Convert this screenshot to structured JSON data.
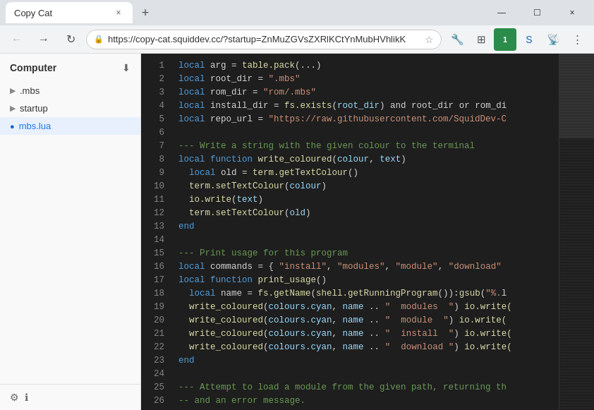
{
  "browser": {
    "title": "Copy Cat",
    "tab_close": "×",
    "new_tab": "+",
    "minimize": "—",
    "maximize": "☐",
    "close": "×",
    "back": "←",
    "forward": "→",
    "reload": "↻",
    "url": "https://copy-cat.squiddev.cc/?startup=ZnMuZGVsZXRlKCtYnMubHVhlikK",
    "star": "☆",
    "lock": "🔒"
  },
  "sidebar": {
    "title": "Computer",
    "download_icon": "⬇",
    "items": [
      {
        "id": "mbs",
        "icon": "▶",
        "label": ".mbs",
        "active": false
      },
      {
        "id": "startup",
        "icon": "▶",
        "label": "startup",
        "active": false
      },
      {
        "id": "mbs-lua",
        "icon": "●",
        "label": "mbs.lua",
        "active": true
      }
    ],
    "footer": {
      "settings_icon": "⚙",
      "info_icon": "ℹ"
    }
  },
  "code": {
    "lines": [
      {
        "num": 1,
        "tokens": [
          {
            "t": "kw",
            "v": "local"
          },
          {
            "t": "op",
            "v": " arg = "
          },
          {
            "t": "fn",
            "v": "table.pack"
          },
          {
            "t": "punc",
            "v": "(...)"
          }
        ]
      },
      {
        "num": 2,
        "tokens": [
          {
            "t": "kw",
            "v": "local"
          },
          {
            "t": "op",
            "v": " root_dir = "
          },
          {
            "t": "str",
            "v": "\".mbs\""
          }
        ]
      },
      {
        "num": 3,
        "tokens": [
          {
            "t": "kw",
            "v": "local"
          },
          {
            "t": "op",
            "v": " rom_dir = "
          },
          {
            "t": "str",
            "v": "\"rom/.mbs\""
          }
        ]
      },
      {
        "num": 4,
        "tokens": [
          {
            "t": "kw",
            "v": "local"
          },
          {
            "t": "op",
            "v": " install_dir = "
          },
          {
            "t": "fn",
            "v": "fs.exists"
          },
          {
            "t": "punc",
            "v": "("
          },
          {
            "t": "var",
            "v": "root_dir"
          },
          {
            "t": "punc",
            "v": ")"
          },
          {
            "t": "op",
            "v": " and root_dir or rom_di"
          }
        ]
      },
      {
        "num": 5,
        "tokens": [
          {
            "t": "kw",
            "v": "local"
          },
          {
            "t": "op",
            "v": " repo_url = "
          },
          {
            "t": "str",
            "v": "\"https://raw.githubusercontent.com/SquidDev-C"
          }
        ]
      },
      {
        "num": 6,
        "tokens": []
      },
      {
        "num": 7,
        "tokens": [
          {
            "t": "comment",
            "v": "--- Write a string with the given colour to the terminal"
          }
        ]
      },
      {
        "num": 8,
        "tokens": [
          {
            "t": "kw",
            "v": "local"
          },
          {
            "t": "op",
            "v": " "
          },
          {
            "t": "kw",
            "v": "function"
          },
          {
            "t": "op",
            "v": " "
          },
          {
            "t": "fn",
            "v": "write_coloured"
          },
          {
            "t": "punc",
            "v": "("
          },
          {
            "t": "var",
            "v": "colour"
          },
          {
            "t": "punc",
            "v": ", "
          },
          {
            "t": "var",
            "v": "text"
          },
          {
            "t": "punc",
            "v": ")"
          }
        ]
      },
      {
        "num": 9,
        "tokens": [
          {
            "t": "indent",
            "v": "  "
          },
          {
            "t": "kw",
            "v": "local"
          },
          {
            "t": "op",
            "v": " old = "
          },
          {
            "t": "fn",
            "v": "term.getTextColour"
          },
          {
            "t": "punc",
            "v": "()"
          }
        ]
      },
      {
        "num": 10,
        "tokens": [
          {
            "t": "indent",
            "v": "  "
          },
          {
            "t": "fn",
            "v": "term.setTextColour"
          },
          {
            "t": "punc",
            "v": "("
          },
          {
            "t": "var",
            "v": "colour"
          },
          {
            "t": "punc",
            "v": ")"
          }
        ]
      },
      {
        "num": 11,
        "tokens": [
          {
            "t": "indent",
            "v": "  "
          },
          {
            "t": "fn",
            "v": "io.write"
          },
          {
            "t": "punc",
            "v": "("
          },
          {
            "t": "var",
            "v": "text"
          },
          {
            "t": "punc",
            "v": ")"
          }
        ]
      },
      {
        "num": 12,
        "tokens": [
          {
            "t": "indent",
            "v": "  "
          },
          {
            "t": "fn",
            "v": "term.setTextColour"
          },
          {
            "t": "punc",
            "v": "("
          },
          {
            "t": "var",
            "v": "old"
          },
          {
            "t": "punc",
            "v": ")"
          }
        ]
      },
      {
        "num": 13,
        "tokens": [
          {
            "t": "kw",
            "v": "end"
          }
        ]
      },
      {
        "num": 14,
        "tokens": []
      },
      {
        "num": 15,
        "tokens": [
          {
            "t": "comment",
            "v": "--- Print usage for this program"
          }
        ]
      },
      {
        "num": 16,
        "tokens": [
          {
            "t": "kw",
            "v": "local"
          },
          {
            "t": "op",
            "v": " commands = { "
          },
          {
            "t": "str",
            "v": "\"install\""
          },
          {
            "t": "op",
            "v": ", "
          },
          {
            "t": "str",
            "v": "\"modules\""
          },
          {
            "t": "op",
            "v": ", "
          },
          {
            "t": "str",
            "v": "\"module\""
          },
          {
            "t": "op",
            "v": ", "
          },
          {
            "t": "str",
            "v": "\"download\""
          }
        ]
      },
      {
        "num": 17,
        "tokens": [
          {
            "t": "kw",
            "v": "local"
          },
          {
            "t": "op",
            "v": " "
          },
          {
            "t": "kw",
            "v": "function"
          },
          {
            "t": "op",
            "v": " "
          },
          {
            "t": "fn",
            "v": "print_usage"
          },
          {
            "t": "punc",
            "v": "()"
          }
        ]
      },
      {
        "num": 18,
        "tokens": [
          {
            "t": "indent",
            "v": "  "
          },
          {
            "t": "kw",
            "v": "local"
          },
          {
            "t": "op",
            "v": " name = "
          },
          {
            "t": "fn",
            "v": "fs.getName"
          },
          {
            "t": "punc",
            "v": "("
          },
          {
            "t": "fn",
            "v": "shell.getRunningProgram"
          },
          {
            "t": "punc",
            "v": "()):"
          },
          {
            "t": "fn",
            "v": "gsub"
          },
          {
            "t": "punc",
            "v": "("
          },
          {
            "t": "str",
            "v": "\"%."
          },
          {
            "t": "op",
            "v": "l"
          }
        ]
      },
      {
        "num": 19,
        "tokens": [
          {
            "t": "indent",
            "v": "  "
          },
          {
            "t": "fn",
            "v": "write_coloured"
          },
          {
            "t": "punc",
            "v": "("
          },
          {
            "t": "var",
            "v": "colours.cyan"
          },
          {
            "t": "punc",
            "v": ", "
          },
          {
            "t": "var",
            "v": "name"
          },
          {
            "t": "op",
            "v": " .. "
          },
          {
            "t": "str",
            "v": "\"  modules  \""
          },
          {
            "t": "punc",
            "v": ")"
          },
          {
            "t": "op",
            "v": " "
          },
          {
            "t": "fn",
            "v": "io.write("
          }
        ]
      },
      {
        "num": 20,
        "tokens": [
          {
            "t": "indent",
            "v": "  "
          },
          {
            "t": "fn",
            "v": "write_coloured"
          },
          {
            "t": "punc",
            "v": "("
          },
          {
            "t": "var",
            "v": "colours.cyan"
          },
          {
            "t": "punc",
            "v": ", "
          },
          {
            "t": "var",
            "v": "name"
          },
          {
            "t": "op",
            "v": " .. "
          },
          {
            "t": "str",
            "v": "\"  module  \""
          },
          {
            "t": "punc",
            "v": ")"
          },
          {
            "t": "op",
            "v": " "
          },
          {
            "t": "fn",
            "v": "io.write("
          }
        ]
      },
      {
        "num": 21,
        "tokens": [
          {
            "t": "indent",
            "v": "  "
          },
          {
            "t": "fn",
            "v": "write_coloured"
          },
          {
            "t": "punc",
            "v": "("
          },
          {
            "t": "var",
            "v": "colours.cyan"
          },
          {
            "t": "punc",
            "v": ", "
          },
          {
            "t": "var",
            "v": "name"
          },
          {
            "t": "op",
            "v": " .. "
          },
          {
            "t": "str",
            "v": "\"  install  \""
          },
          {
            "t": "punc",
            "v": ")"
          },
          {
            "t": "op",
            "v": " "
          },
          {
            "t": "fn",
            "v": "io.write("
          }
        ]
      },
      {
        "num": 22,
        "tokens": [
          {
            "t": "indent",
            "v": "  "
          },
          {
            "t": "fn",
            "v": "write_coloured"
          },
          {
            "t": "punc",
            "v": "("
          },
          {
            "t": "var",
            "v": "colours.cyan"
          },
          {
            "t": "punc",
            "v": ", "
          },
          {
            "t": "var",
            "v": "name"
          },
          {
            "t": "op",
            "v": " .. "
          },
          {
            "t": "str",
            "v": "\"  download \""
          },
          {
            "t": "punc",
            "v": ")"
          },
          {
            "t": "op",
            "v": " "
          },
          {
            "t": "fn",
            "v": "io.write("
          }
        ]
      },
      {
        "num": 23,
        "tokens": [
          {
            "t": "kw",
            "v": "end"
          }
        ]
      },
      {
        "num": 24,
        "tokens": []
      },
      {
        "num": 25,
        "tokens": [
          {
            "t": "comment",
            "v": "--- Attempt to load a module from the given path, returning th"
          }
        ]
      },
      {
        "num": 26,
        "tokens": [
          {
            "t": "comment",
            "v": "-- and an error message."
          }
        ]
      }
    ]
  }
}
